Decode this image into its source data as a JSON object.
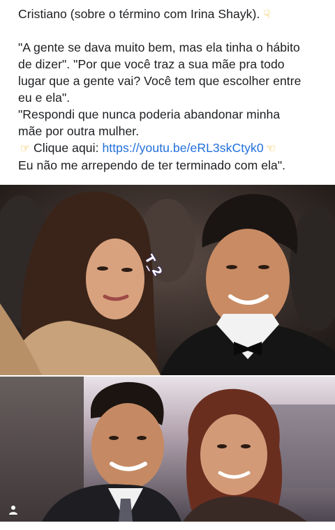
{
  "post": {
    "line1": "Cristiano (sobre o término com Irina Shayk).",
    "quote1_line1": "\"A gente se dava muito bem, mas ela tinha o hábito",
    "quote1_line2": "de dizer\". \"Por que você traz a sua mãe pra todo",
    "quote1_line3": "lugar que a gente vai? Você tem que escolher entre",
    "quote1_line4": "eu e ela\".",
    "quote2_line1": "\"Respondi que nunca poderia abandonar minha",
    "quote2_line2": "mãe por outra mulher.",
    "click_label": "Clique aqui: ",
    "link_text": "https://youtu.be/eRL3skCtyk0",
    "last_line": "Eu não me arrependo de ter terminado com ela\"."
  },
  "photos": {
    "top_watermark": "T_2"
  },
  "icons": {
    "pointing_down": "backhand-index-pointing-down-emoji",
    "pointing_right": "backhand-index-pointing-right-emoji",
    "pointing_left": "backhand-index-pointing-left-emoji",
    "person": "person-icon"
  },
  "colors": {
    "text": "#1c1e21",
    "link": "#216fdb",
    "emoji": "#f0b41e"
  }
}
